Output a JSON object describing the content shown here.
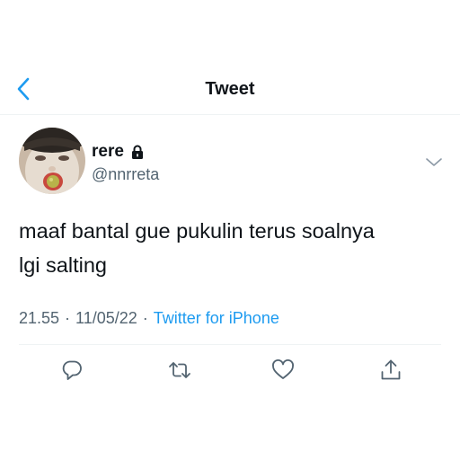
{
  "header": {
    "title": "Tweet",
    "back_icon": "chevron-left-icon"
  },
  "tweet": {
    "author": {
      "display_name": "rere",
      "handle": "@nnrreta",
      "protected_icon": "lock-icon"
    },
    "text_line1": "maaf bantal gue pukulin terus soalnya",
    "text_line2": "lgi salting",
    "time": "21.55",
    "date": "11/05/22",
    "separator": "·",
    "source": "Twitter for iPhone"
  },
  "actions": [
    {
      "icon": "reply-icon"
    },
    {
      "icon": "retweet-icon"
    },
    {
      "icon": "like-icon"
    },
    {
      "icon": "share-icon"
    }
  ],
  "colors": {
    "accent": "#1d9bf0",
    "text": "#0f1419",
    "secondary": "#536471",
    "divider": "#eff3f4"
  }
}
